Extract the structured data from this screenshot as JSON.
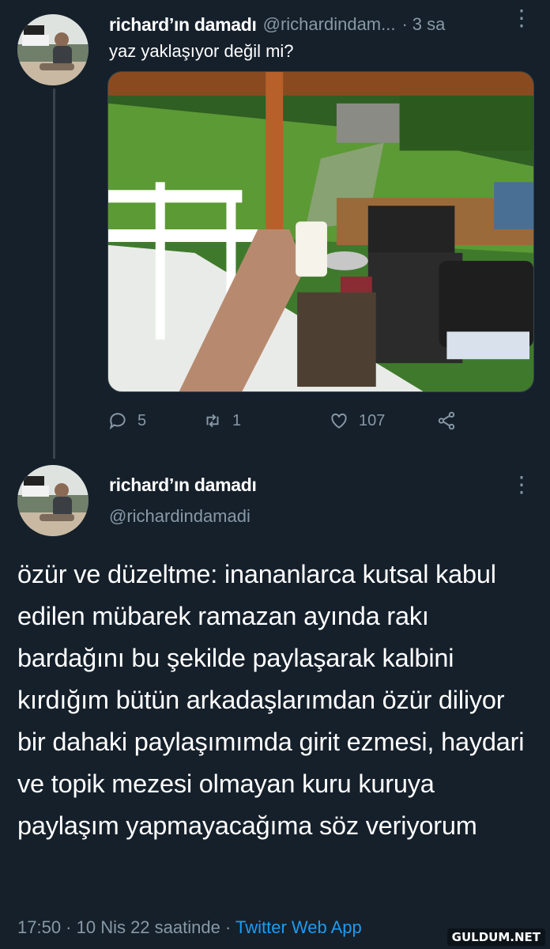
{
  "tweet1": {
    "author_name": "richard’ın damadı",
    "author_handle": "@richardindam...",
    "separator": "·",
    "time": "3 sa",
    "text": "yaz yaklaşıyor değil mi?",
    "counts": {
      "replies": "5",
      "retweets": "1",
      "likes": "107"
    }
  },
  "tweet2": {
    "author_name": "richard’ın damadı",
    "author_handle": "@richardindamadi",
    "text": "özür ve düzeltme: inananlarca kutsal kabul edilen mübarek ramazan ayında rakı bardağını bu şekilde paylaşarak kalbini kırdığım bütün arkadaşlarımdan özür diliyor bir dahaki paylaşımımda girit ezmesi, haydari ve topik mezesi olmayan kuru kuruya paylaşım yapmayacağıma söz veriyorum",
    "timestamp": "17:50 · 10 Nis 22 saatinde · ",
    "source": "Twitter Web App"
  },
  "icons": {
    "reply": "reply-icon",
    "retweet": "retweet-icon",
    "like": "heart-icon",
    "share": "share-icon",
    "more": "more-icon"
  },
  "colors": {
    "background": "#15202b",
    "text": "#ffffff",
    "secondary": "#8899a6",
    "link": "#1d9bf0",
    "thread_line": "#38444d"
  },
  "watermark": "GULDUM.NET"
}
